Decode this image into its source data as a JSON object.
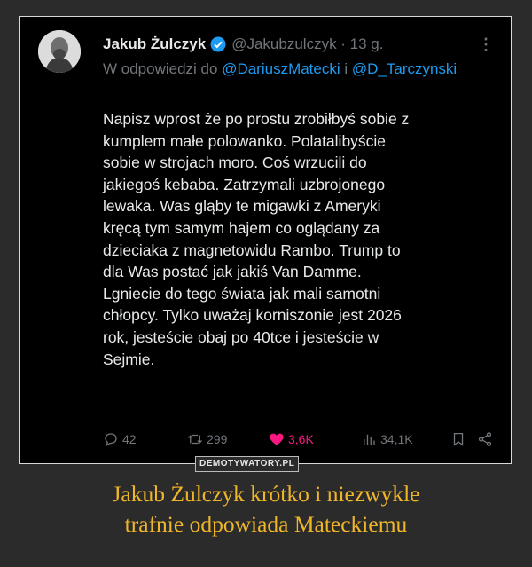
{
  "tweet": {
    "author_name": "Jakub Żulczyk",
    "handle_time": "@Jakubzulczyk · 13 g.",
    "reply_prefix": "W odpowiedzi do ",
    "reply_mention_1": "@DariuszMatecki",
    "reply_and": " i ",
    "reply_mention_2": "@D_Tarczynski",
    "text": "Napisz wprost że po prostu zrobiłbyś sobie z\nkumplem małe polowanko. Polatalibyście\nsobie w strojach moro. Coś wrzucili do\njakiegoś kebaba. Zatrzymali uzbrojonego\nlewaka. Was gląby te migawki z Ameryki\nkręcą tym samym hajem co oglądany za\ndzieciaka z magnetowidu Rambo. Trump to\ndla Was postać jak jakiś Van Damme.\nLgniecie do tego świata jak mali samotni\nchłopcy. Tylko uważaj korniszonie jest 2026\nrok, jesteście obaj po 40tce i jesteście w\nSejmie.",
    "replies": "42",
    "retweets": "299",
    "likes": "3,6K",
    "views": "34,1K"
  },
  "watermark": "DEMOTYWATORY.PL",
  "caption": {
    "line1": "Jakub Żulczyk krótko i niezwykle",
    "line2": "trafnie odpowiada Mateckiemu"
  },
  "colors": {
    "like": "#f91880",
    "link": "#1d9bf0",
    "caption": "#f0b62a"
  },
  "icons": [
    "verified-badge-icon",
    "more-icon",
    "reply-icon",
    "retweet-icon",
    "heart-icon",
    "views-icon",
    "bookmark-icon",
    "share-icon"
  ]
}
